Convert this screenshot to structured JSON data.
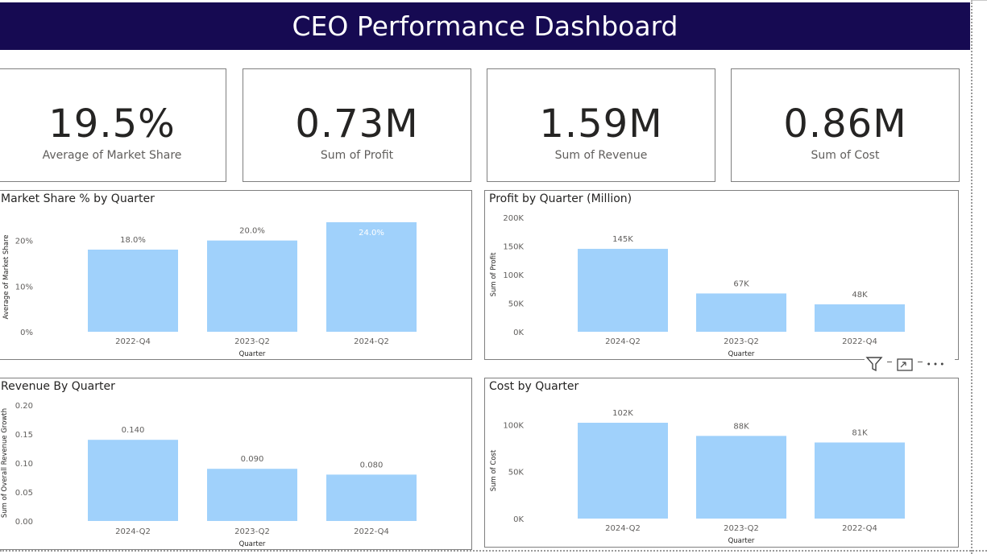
{
  "header": {
    "title": "CEO Performance Dashboard"
  },
  "kpis": [
    {
      "value": "19.5%",
      "label": "Average of Market Share"
    },
    {
      "value": "0.73M",
      "label": "Sum of Profit"
    },
    {
      "value": "1.59M",
      "label": "Sum of Revenue"
    },
    {
      "value": "0.86M",
      "label": "Sum of Cost"
    }
  ],
  "toolbar": {
    "filter_icon": "filter-icon",
    "focus_icon": "focus-mode-icon",
    "more_icon": "more-options-icon"
  },
  "colors": {
    "bar": "#a0d1fb",
    "header": "#160a52",
    "text": "#252423",
    "axis_text": "#605e5c"
  },
  "chart_data": [
    {
      "type": "bar",
      "title": "Market Share % by Quarter",
      "xlabel": "Quarter",
      "ylabel": "Average of Market Share",
      "categories": [
        "2022-Q4",
        "2023-Q2",
        "2024-Q2"
      ],
      "values": [
        18.0,
        20.0,
        24.0
      ],
      "data_labels": [
        "18.0%",
        "20.0%",
        "24.0%"
      ],
      "yticks": [
        0,
        10,
        20
      ],
      "ytick_labels": [
        "0%",
        "10%",
        "20%"
      ],
      "ylim": [
        0,
        24
      ],
      "grid": false
    },
    {
      "type": "bar",
      "title": "Profit by Quarter (Million)",
      "xlabel": "Quarter",
      "ylabel": "Sum of Profit",
      "categories": [
        "2024-Q2",
        "2023-Q2",
        "2022-Q4"
      ],
      "values": [
        145000,
        67000,
        48000
      ],
      "data_labels": [
        "145K",
        "67K",
        "48K"
      ],
      "yticks": [
        0,
        50000,
        100000,
        150000,
        200000
      ],
      "ytick_labels": [
        "0K",
        "50K",
        "100K",
        "150K",
        "200K"
      ],
      "ylim": [
        0,
        200000
      ],
      "grid": false
    },
    {
      "type": "bar",
      "title": "Revenue By Quarter",
      "xlabel": "Quarter",
      "ylabel": "Sum of Overall Revenue Growth",
      "categories": [
        "2024-Q2",
        "2023-Q2",
        "2022-Q4"
      ],
      "values": [
        0.14,
        0.09,
        0.08
      ],
      "data_labels": [
        "0.140",
        "0.090",
        "0.080"
      ],
      "yticks": [
        0,
        0.05,
        0.1,
        0.15,
        0.2
      ],
      "ytick_labels": [
        "0.00",
        "0.05",
        "0.10",
        "0.15",
        "0.20"
      ],
      "ylim": [
        0,
        0.2
      ],
      "grid": false
    },
    {
      "type": "bar",
      "title": "Cost by Quarter",
      "xlabel": "Quarter",
      "ylabel": "Sum of Cost",
      "categories": [
        "2024-Q2",
        "2023-Q2",
        "2022-Q4"
      ],
      "values": [
        102000,
        88000,
        81000
      ],
      "data_labels": [
        "102K",
        "88K",
        "81K"
      ],
      "yticks": [
        0,
        50000,
        100000
      ],
      "ytick_labels": [
        "0K",
        "50K",
        "100K"
      ],
      "ylim": [
        0,
        102000
      ],
      "grid": false
    }
  ]
}
